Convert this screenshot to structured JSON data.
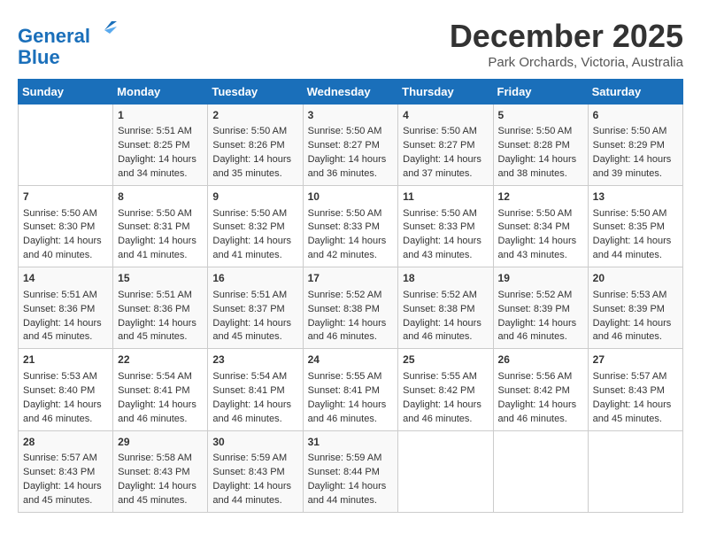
{
  "logo": {
    "line1": "General",
    "line2": "Blue"
  },
  "title": "December 2025",
  "subtitle": "Park Orchards, Victoria, Australia",
  "days_of_week": [
    "Sunday",
    "Monday",
    "Tuesday",
    "Wednesday",
    "Thursday",
    "Friday",
    "Saturday"
  ],
  "weeks": [
    [
      {
        "day": "",
        "info": ""
      },
      {
        "day": "1",
        "info": "Sunrise: 5:51 AM\nSunset: 8:25 PM\nDaylight: 14 hours\nand 34 minutes."
      },
      {
        "day": "2",
        "info": "Sunrise: 5:50 AM\nSunset: 8:26 PM\nDaylight: 14 hours\nand 35 minutes."
      },
      {
        "day": "3",
        "info": "Sunrise: 5:50 AM\nSunset: 8:27 PM\nDaylight: 14 hours\nand 36 minutes."
      },
      {
        "day": "4",
        "info": "Sunrise: 5:50 AM\nSunset: 8:27 PM\nDaylight: 14 hours\nand 37 minutes."
      },
      {
        "day": "5",
        "info": "Sunrise: 5:50 AM\nSunset: 8:28 PM\nDaylight: 14 hours\nand 38 minutes."
      },
      {
        "day": "6",
        "info": "Sunrise: 5:50 AM\nSunset: 8:29 PM\nDaylight: 14 hours\nand 39 minutes."
      }
    ],
    [
      {
        "day": "7",
        "info": "Sunrise: 5:50 AM\nSunset: 8:30 PM\nDaylight: 14 hours\nand 40 minutes."
      },
      {
        "day": "8",
        "info": "Sunrise: 5:50 AM\nSunset: 8:31 PM\nDaylight: 14 hours\nand 41 minutes."
      },
      {
        "day": "9",
        "info": "Sunrise: 5:50 AM\nSunset: 8:32 PM\nDaylight: 14 hours\nand 41 minutes."
      },
      {
        "day": "10",
        "info": "Sunrise: 5:50 AM\nSunset: 8:33 PM\nDaylight: 14 hours\nand 42 minutes."
      },
      {
        "day": "11",
        "info": "Sunrise: 5:50 AM\nSunset: 8:33 PM\nDaylight: 14 hours\nand 43 minutes."
      },
      {
        "day": "12",
        "info": "Sunrise: 5:50 AM\nSunset: 8:34 PM\nDaylight: 14 hours\nand 43 minutes."
      },
      {
        "day": "13",
        "info": "Sunrise: 5:50 AM\nSunset: 8:35 PM\nDaylight: 14 hours\nand 44 minutes."
      }
    ],
    [
      {
        "day": "14",
        "info": "Sunrise: 5:51 AM\nSunset: 8:36 PM\nDaylight: 14 hours\nand 45 minutes."
      },
      {
        "day": "15",
        "info": "Sunrise: 5:51 AM\nSunset: 8:36 PM\nDaylight: 14 hours\nand 45 minutes."
      },
      {
        "day": "16",
        "info": "Sunrise: 5:51 AM\nSunset: 8:37 PM\nDaylight: 14 hours\nand 45 minutes."
      },
      {
        "day": "17",
        "info": "Sunrise: 5:52 AM\nSunset: 8:38 PM\nDaylight: 14 hours\nand 46 minutes."
      },
      {
        "day": "18",
        "info": "Sunrise: 5:52 AM\nSunset: 8:38 PM\nDaylight: 14 hours\nand 46 minutes."
      },
      {
        "day": "19",
        "info": "Sunrise: 5:52 AM\nSunset: 8:39 PM\nDaylight: 14 hours\nand 46 minutes."
      },
      {
        "day": "20",
        "info": "Sunrise: 5:53 AM\nSunset: 8:39 PM\nDaylight: 14 hours\nand 46 minutes."
      }
    ],
    [
      {
        "day": "21",
        "info": "Sunrise: 5:53 AM\nSunset: 8:40 PM\nDaylight: 14 hours\nand 46 minutes."
      },
      {
        "day": "22",
        "info": "Sunrise: 5:54 AM\nSunset: 8:41 PM\nDaylight: 14 hours\nand 46 minutes."
      },
      {
        "day": "23",
        "info": "Sunrise: 5:54 AM\nSunset: 8:41 PM\nDaylight: 14 hours\nand 46 minutes."
      },
      {
        "day": "24",
        "info": "Sunrise: 5:55 AM\nSunset: 8:41 PM\nDaylight: 14 hours\nand 46 minutes."
      },
      {
        "day": "25",
        "info": "Sunrise: 5:55 AM\nSunset: 8:42 PM\nDaylight: 14 hours\nand 46 minutes."
      },
      {
        "day": "26",
        "info": "Sunrise: 5:56 AM\nSunset: 8:42 PM\nDaylight: 14 hours\nand 46 minutes."
      },
      {
        "day": "27",
        "info": "Sunrise: 5:57 AM\nSunset: 8:43 PM\nDaylight: 14 hours\nand 45 minutes."
      }
    ],
    [
      {
        "day": "28",
        "info": "Sunrise: 5:57 AM\nSunset: 8:43 PM\nDaylight: 14 hours\nand 45 minutes."
      },
      {
        "day": "29",
        "info": "Sunrise: 5:58 AM\nSunset: 8:43 PM\nDaylight: 14 hours\nand 45 minutes."
      },
      {
        "day": "30",
        "info": "Sunrise: 5:59 AM\nSunset: 8:43 PM\nDaylight: 14 hours\nand 44 minutes."
      },
      {
        "day": "31",
        "info": "Sunrise: 5:59 AM\nSunset: 8:44 PM\nDaylight: 14 hours\nand 44 minutes."
      },
      {
        "day": "",
        "info": ""
      },
      {
        "day": "",
        "info": ""
      },
      {
        "day": "",
        "info": ""
      }
    ]
  ]
}
